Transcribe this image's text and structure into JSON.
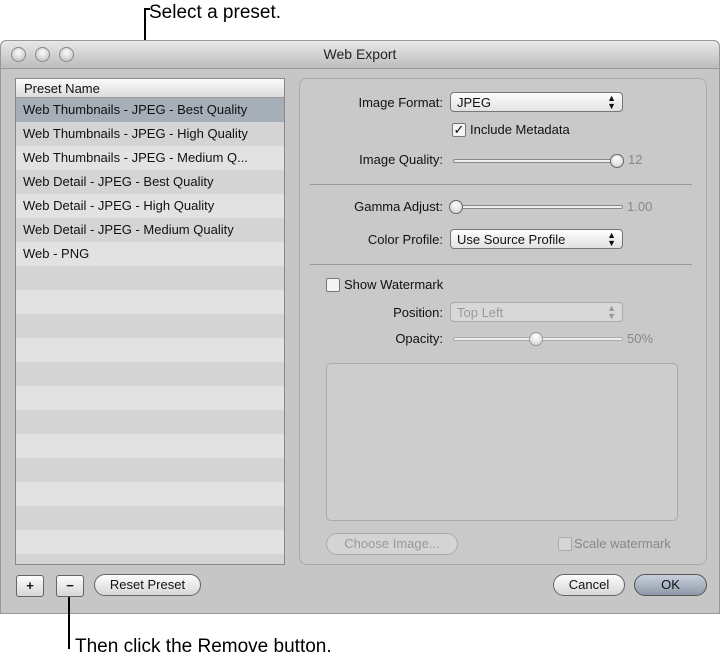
{
  "annotations": {
    "top": "Select a preset.",
    "bottom": "Then click the Remove button."
  },
  "window": {
    "title": "Web Export"
  },
  "preset_list": {
    "header": "Preset Name",
    "items": [
      "Web Thumbnails - JPEG - Best Quality",
      "Web Thumbnails - JPEG - High Quality",
      "Web Thumbnails - JPEG - Medium Q...",
      "Web Detail - JPEG - Best Quality",
      "Web Detail - JPEG - High Quality",
      "Web Detail - JPEG - Medium Quality",
      "Web - PNG"
    ],
    "selected_index": 0
  },
  "settings": {
    "image_format_label": "Image Format:",
    "image_format": "JPEG",
    "include_metadata_label": "Include Metadata",
    "include_metadata": true,
    "image_quality_label": "Image Quality:",
    "image_quality": "12",
    "gamma_label": "Gamma Adjust:",
    "gamma": "1.00",
    "color_profile_label": "Color Profile:",
    "color_profile": "Use Source Profile",
    "show_watermark_label": "Show Watermark",
    "show_watermark": false,
    "position_label": "Position:",
    "position": "Top Left",
    "opacity_label": "Opacity:",
    "opacity": "50%",
    "choose_image": "Choose Image...",
    "scale_watermark_label": "Scale watermark"
  },
  "buttons": {
    "add": "+",
    "remove": "−",
    "reset": "Reset Preset",
    "cancel": "Cancel",
    "ok": "OK"
  }
}
